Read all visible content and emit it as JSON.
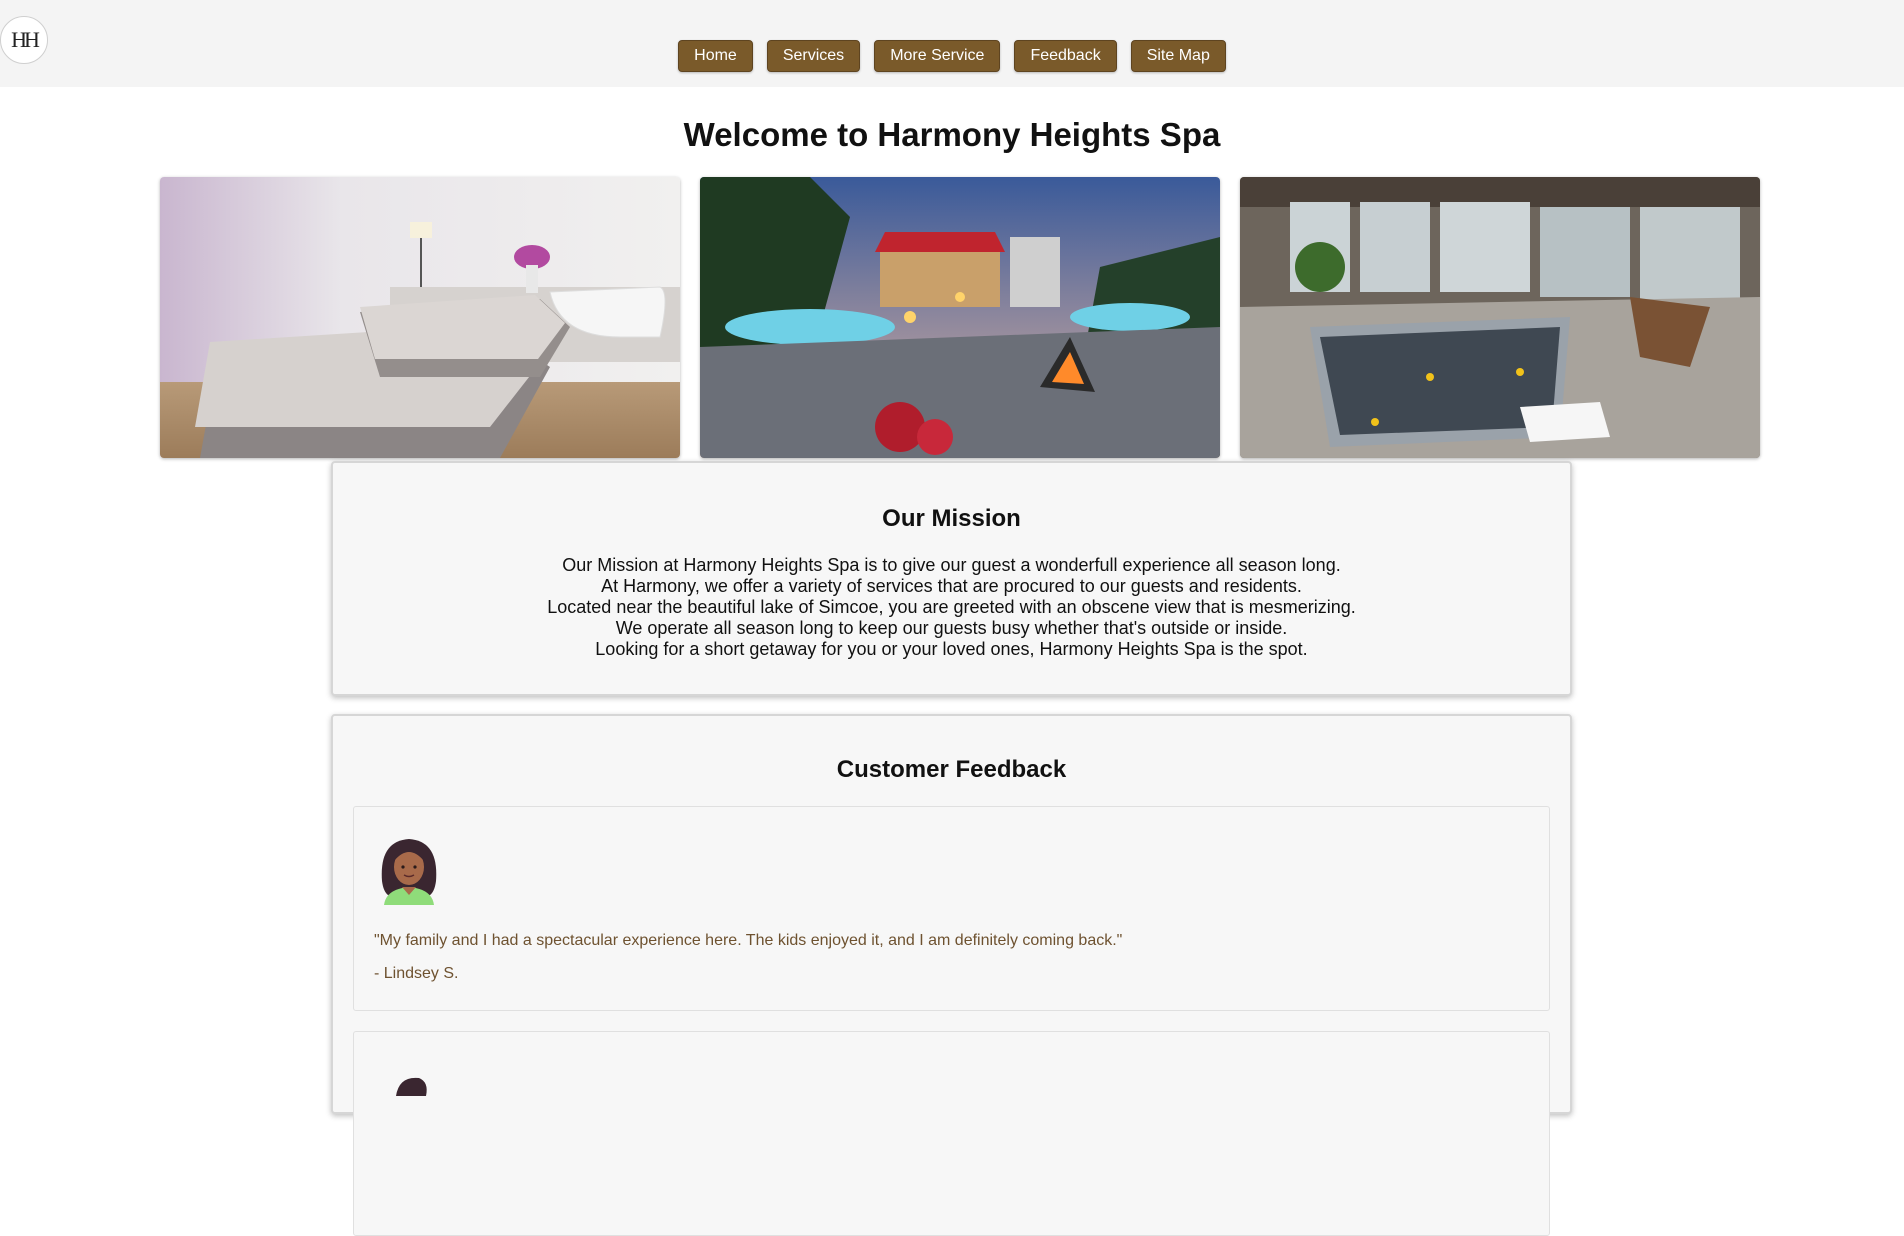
{
  "logo": {
    "text": "HH"
  },
  "nav": {
    "items": [
      "Home",
      "Services",
      "More Service",
      "Feedback",
      "Site Map"
    ]
  },
  "page": {
    "title": "Welcome to Harmony Heights Spa"
  },
  "gallery": {
    "icons": [
      "massage-room-photo",
      "outdoor-pool-night-photo",
      "indoor-hot-tub-photo"
    ]
  },
  "mission": {
    "heading": "Our Mission",
    "lines": [
      "Our Mission at Harmony Heights Spa is to give our guest a wonderfull experience all season long.",
      "At Harmony, we offer a variety of services that are procured to our guests and residents.",
      "Located near the beautiful lake of Simcoe, you are greeted with an obscene view that is mesmerizing.",
      "We operate all season long to keep our guests busy whether that's outside or inside.",
      "Looking for a short getaway for you or your loved ones, Harmony Heights Spa is the spot."
    ]
  },
  "feedback": {
    "heading": "Customer Feedback",
    "reviews": [
      {
        "quote": "\"My family and I had a spectacular experience here. The kids enjoyed it, and I am definitely coming back.\"",
        "author": "- Lindsey S."
      },
      {
        "quote": "",
        "author": ""
      }
    ]
  },
  "colors": {
    "nav_bg": "#7a5a2a",
    "quote_text": "#6e5230",
    "topbar_bg": "#f4f4f4"
  }
}
